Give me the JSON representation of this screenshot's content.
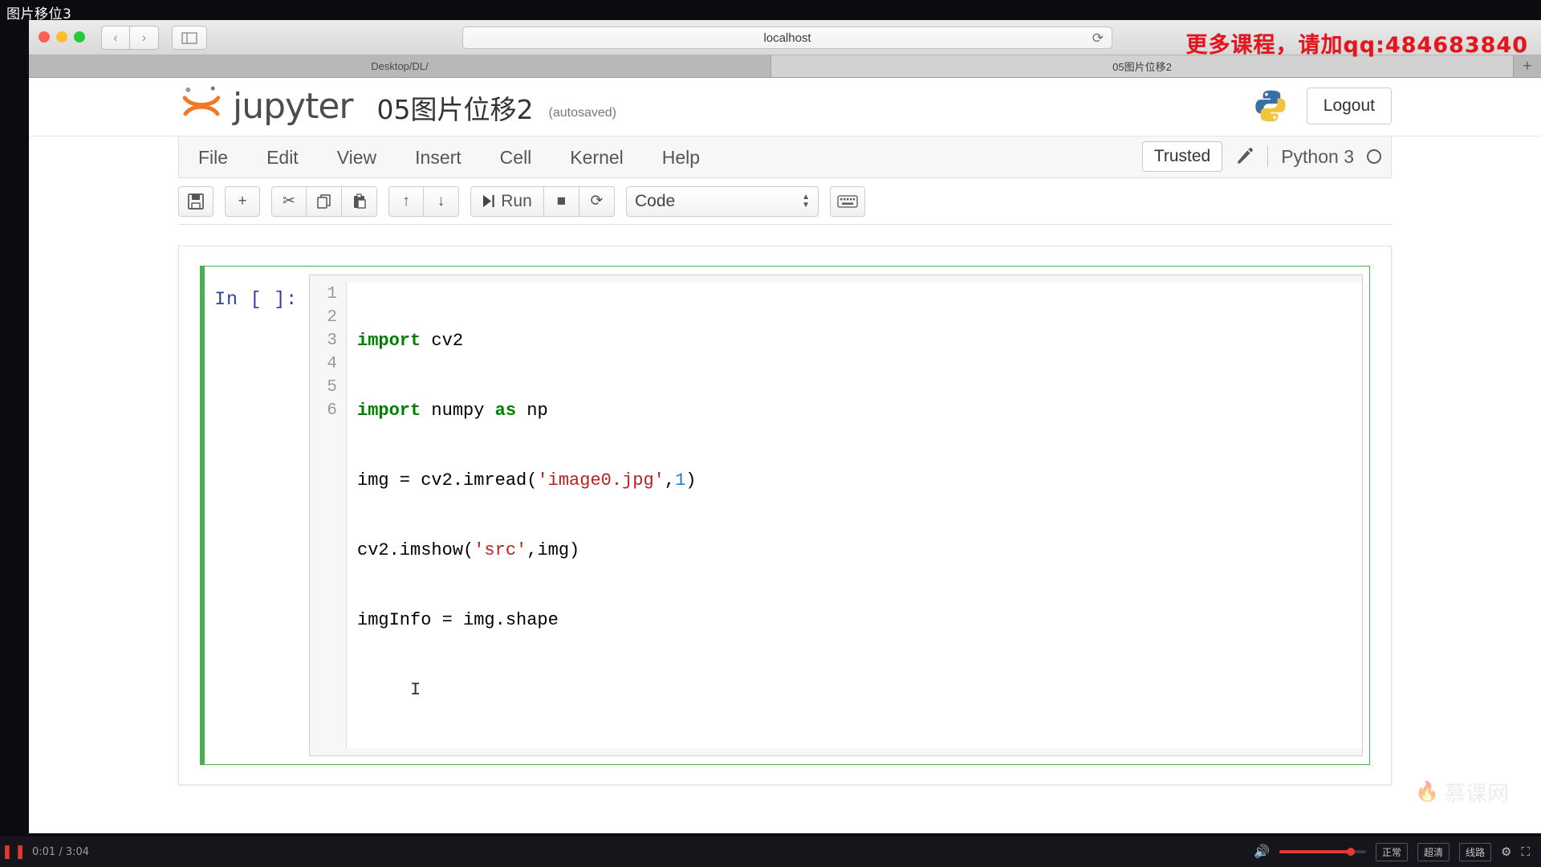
{
  "video": {
    "title": "图片移位3",
    "current_time": "0:01",
    "duration": "3:04",
    "time_display": "0:01 / 3:04",
    "pause_glyph": "❚❚",
    "volume_icon": "volume-icon",
    "quality_options": [
      "正常",
      "超清",
      "线路"
    ],
    "settings_icon": "gear-icon",
    "fullscreen_icon": "fullscreen-icon"
  },
  "promo": {
    "text": "更多课程，请加qq:484683840",
    "color": "#e8141c"
  },
  "watermark": {
    "text": "慕课网",
    "flame": "🔥"
  },
  "browser": {
    "back_glyph": "‹",
    "forward_glyph": "›",
    "sidebar_icon": "sidebar-icon",
    "url": "localhost",
    "reload_glyph": "⟳",
    "tabs": [
      {
        "label": "Desktop/DL/",
        "active": false
      },
      {
        "label": "05图片位移2",
        "active": true
      }
    ],
    "new_tab_glyph": "+"
  },
  "jupyter": {
    "wordmark": "jupyter",
    "notebook_name": "05图片位移2",
    "autosave_status": "(autosaved)",
    "logout_label": "Logout",
    "python_logo": "python-logo",
    "menu": [
      "File",
      "Edit",
      "View",
      "Insert",
      "Cell",
      "Kernel",
      "Help"
    ],
    "trusted_label": "Trusted",
    "edit_icon": "pencil-icon",
    "kernel_name": "Python 3",
    "kernel_indicator": "kernel-idle-circle",
    "toolbar": {
      "save": "save-icon",
      "add": "+",
      "cut": "✂",
      "copy": "copy-icon",
      "paste": "paste-icon",
      "move_up": "↑",
      "move_down": "↓",
      "run_label": "Run",
      "run_icon": "▶❘",
      "stop": "■",
      "restart": "⟳",
      "cell_type": "Code",
      "keyboard": "keyboard-icon"
    },
    "cell": {
      "prompt": "In [ ]:",
      "line_numbers": [
        "1",
        "2",
        "3",
        "4",
        "5",
        "6"
      ],
      "code_lines": [
        "import cv2",
        "import numpy as np",
        "img = cv2.imread('image0.jpg',1)",
        "cv2.imshow('src',img)",
        "imgInfo = img.shape",
        ""
      ],
      "cursor_glyph": "I"
    }
  },
  "colors": {
    "jupyter_orange": "#f37726",
    "cell_selected_green": "#4caf50",
    "string_red": "#ba2121",
    "keyword_green": "#008000",
    "prompt_blue": "#303f9f",
    "promo_red": "#e8141c"
  }
}
